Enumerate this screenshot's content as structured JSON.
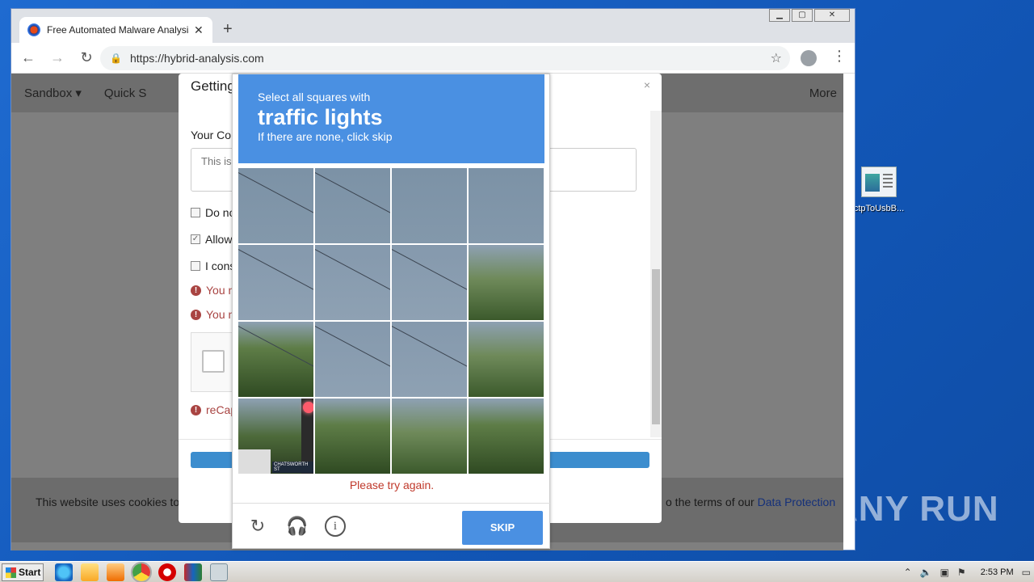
{
  "browser": {
    "tab_title": "Free Automated Malware Analysis S",
    "tab_close": "✕",
    "new_tab": "+",
    "url": "https://hybrid-analysis.com",
    "window_controls": {
      "minimize": "▁",
      "restore": "▢",
      "close": "✕"
    }
  },
  "site": {
    "nav": {
      "sandbox": "Sandbox ▾",
      "quick_scan": "Quick S",
      "more": "More"
    },
    "cookie_left": "This website uses cookies to",
    "cookie_right_prefix": "o the terms of our ",
    "cookie_link": "Data Protection"
  },
  "modal": {
    "title": "Getting",
    "close": "×",
    "comment_label": "Your Cor",
    "comment_placeholder": "This is",
    "checkboxes": [
      {
        "label": "Do no",
        "checked": false
      },
      {
        "label": "Allow",
        "checked": true
      },
      {
        "label": "I cons",
        "checked": false
      }
    ],
    "errors": [
      "You n",
      "You n"
    ],
    "recaptcha_error": "reCap"
  },
  "captcha": {
    "instruction": "Select all squares with",
    "target": "traffic lights",
    "hint": "If there are none, click skip",
    "error": "Please try again.",
    "skip_label": "SKIP",
    "sign_text": "CHATSWORTH ST",
    "icons": [
      "reload-icon",
      "headphones-icon",
      "info-icon"
    ]
  },
  "desktop": {
    "icon_label": "ctpToUsbB...",
    "watermark": "ANY RUN"
  },
  "taskbar": {
    "start_label": "Start",
    "clock": "2:53 PM"
  }
}
